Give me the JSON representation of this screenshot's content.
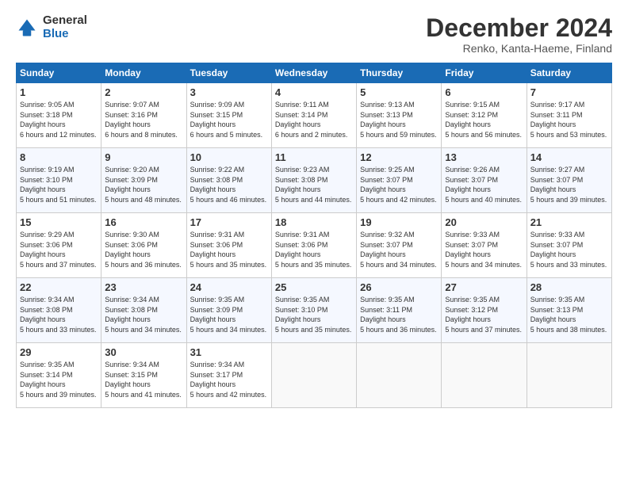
{
  "logo": {
    "general": "General",
    "blue": "Blue"
  },
  "header": {
    "month": "December 2024",
    "location": "Renko, Kanta-Haeme, Finland"
  },
  "days_of_week": [
    "Sunday",
    "Monday",
    "Tuesday",
    "Wednesday",
    "Thursday",
    "Friday",
    "Saturday"
  ],
  "weeks": [
    [
      {
        "day": "1",
        "sunrise": "9:05 AM",
        "sunset": "3:18 PM",
        "daylight": "6 hours and 12 minutes."
      },
      {
        "day": "2",
        "sunrise": "9:07 AM",
        "sunset": "3:16 PM",
        "daylight": "6 hours and 8 minutes."
      },
      {
        "day": "3",
        "sunrise": "9:09 AM",
        "sunset": "3:15 PM",
        "daylight": "6 hours and 5 minutes."
      },
      {
        "day": "4",
        "sunrise": "9:11 AM",
        "sunset": "3:14 PM",
        "daylight": "6 hours and 2 minutes."
      },
      {
        "day": "5",
        "sunrise": "9:13 AM",
        "sunset": "3:13 PM",
        "daylight": "5 hours and 59 minutes."
      },
      {
        "day": "6",
        "sunrise": "9:15 AM",
        "sunset": "3:12 PM",
        "daylight": "5 hours and 56 minutes."
      },
      {
        "day": "7",
        "sunrise": "9:17 AM",
        "sunset": "3:11 PM",
        "daylight": "5 hours and 53 minutes."
      }
    ],
    [
      {
        "day": "8",
        "sunrise": "9:19 AM",
        "sunset": "3:10 PM",
        "daylight": "5 hours and 51 minutes."
      },
      {
        "day": "9",
        "sunrise": "9:20 AM",
        "sunset": "3:09 PM",
        "daylight": "5 hours and 48 minutes."
      },
      {
        "day": "10",
        "sunrise": "9:22 AM",
        "sunset": "3:08 PM",
        "daylight": "5 hours and 46 minutes."
      },
      {
        "day": "11",
        "sunrise": "9:23 AM",
        "sunset": "3:08 PM",
        "daylight": "5 hours and 44 minutes."
      },
      {
        "day": "12",
        "sunrise": "9:25 AM",
        "sunset": "3:07 PM",
        "daylight": "5 hours and 42 minutes."
      },
      {
        "day": "13",
        "sunrise": "9:26 AM",
        "sunset": "3:07 PM",
        "daylight": "5 hours and 40 minutes."
      },
      {
        "day": "14",
        "sunrise": "9:27 AM",
        "sunset": "3:07 PM",
        "daylight": "5 hours and 39 minutes."
      }
    ],
    [
      {
        "day": "15",
        "sunrise": "9:29 AM",
        "sunset": "3:06 PM",
        "daylight": "5 hours and 37 minutes."
      },
      {
        "day": "16",
        "sunrise": "9:30 AM",
        "sunset": "3:06 PM",
        "daylight": "5 hours and 36 minutes."
      },
      {
        "day": "17",
        "sunrise": "9:31 AM",
        "sunset": "3:06 PM",
        "daylight": "5 hours and 35 minutes."
      },
      {
        "day": "18",
        "sunrise": "9:31 AM",
        "sunset": "3:06 PM",
        "daylight": "5 hours and 35 minutes."
      },
      {
        "day": "19",
        "sunrise": "9:32 AM",
        "sunset": "3:07 PM",
        "daylight": "5 hours and 34 minutes."
      },
      {
        "day": "20",
        "sunrise": "9:33 AM",
        "sunset": "3:07 PM",
        "daylight": "5 hours and 34 minutes."
      },
      {
        "day": "21",
        "sunrise": "9:33 AM",
        "sunset": "3:07 PM",
        "daylight": "5 hours and 33 minutes."
      }
    ],
    [
      {
        "day": "22",
        "sunrise": "9:34 AM",
        "sunset": "3:08 PM",
        "daylight": "5 hours and 33 minutes."
      },
      {
        "day": "23",
        "sunrise": "9:34 AM",
        "sunset": "3:08 PM",
        "daylight": "5 hours and 34 minutes."
      },
      {
        "day": "24",
        "sunrise": "9:35 AM",
        "sunset": "3:09 PM",
        "daylight": "5 hours and 34 minutes."
      },
      {
        "day": "25",
        "sunrise": "9:35 AM",
        "sunset": "3:10 PM",
        "daylight": "5 hours and 35 minutes."
      },
      {
        "day": "26",
        "sunrise": "9:35 AM",
        "sunset": "3:11 PM",
        "daylight": "5 hours and 36 minutes."
      },
      {
        "day": "27",
        "sunrise": "9:35 AM",
        "sunset": "3:12 PM",
        "daylight": "5 hours and 37 minutes."
      },
      {
        "day": "28",
        "sunrise": "9:35 AM",
        "sunset": "3:13 PM",
        "daylight": "5 hours and 38 minutes."
      }
    ],
    [
      {
        "day": "29",
        "sunrise": "9:35 AM",
        "sunset": "3:14 PM",
        "daylight": "5 hours and 39 minutes."
      },
      {
        "day": "30",
        "sunrise": "9:34 AM",
        "sunset": "3:15 PM",
        "daylight": "5 hours and 41 minutes."
      },
      {
        "day": "31",
        "sunrise": "9:34 AM",
        "sunset": "3:17 PM",
        "daylight": "5 hours and 42 minutes."
      },
      null,
      null,
      null,
      null
    ]
  ]
}
